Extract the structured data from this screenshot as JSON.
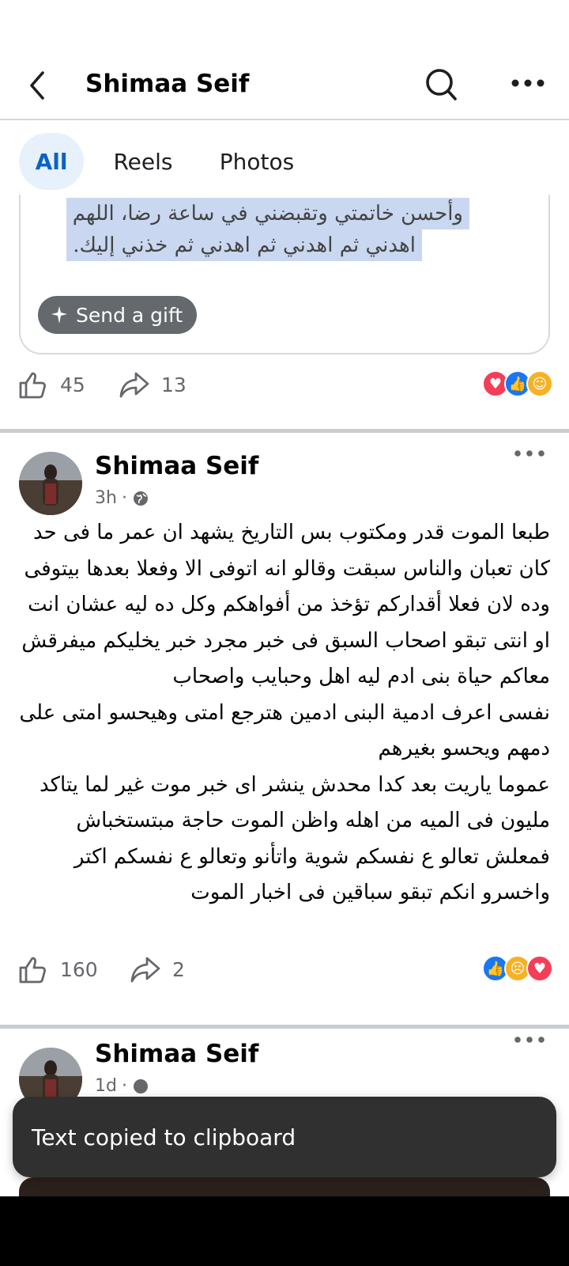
{
  "header": {
    "title": "Shimaa Seif"
  },
  "filters": [
    {
      "label": "All",
      "active": true
    },
    {
      "label": "Reels",
      "active": false
    },
    {
      "label": "Photos",
      "active": false
    }
  ],
  "post_prev": {
    "quote_lines": [
      "وأحسن خاتمتي وتقبضني في ساعة رضا، اللهم",
      "اهدني ثم اهدني ثم اهدني ثم خذني إليك."
    ],
    "gift_label": "Send a gift",
    "likes": "45",
    "shares": "13",
    "reactions": [
      "love",
      "like",
      "care"
    ]
  },
  "post_main": {
    "author": "Shimaa Seif",
    "time": "3h",
    "dot": "·",
    "text": "طبعا الموت قدر ومكتوب بس التاريخ يشهد ان عمر ما فى حد كان تعبان والناس سبقت وقالو انه اتوفى الا وفعلا بعدها بيتوفى وده لان فعلا أقداركم تؤخذ من أفواهكم وكل ده ليه عشان انت او انتى تبقو اصحاب السبق فى خبر مجرد خبر يخليكم ميفرقش معاكم حياة بنى ادم ليه اهل وحبايب واصحاب\nنفسى اعرف ادمية البنى ادمين هترجع امتى وهيحسو امتى على دمهم ويحسو بغيرهم\nعموما ياريت بعد كدا محدش ينشر اى خبر موت غير لما يتاكد مليون فى الميه من اهله واظن الموت حاجة مبتستخباش فمعلش تعالو ع نفسكم شوية واتأنو وتعالو ع نفسكم اكتر واخسرو انكم تبقو سباقين فى اخبار الموت",
    "likes": "160",
    "shares": "2",
    "reactions": [
      "like",
      "sad",
      "love"
    ]
  },
  "post_next": {
    "author": "Shimaa Seif",
    "time": "1d",
    "dot": "·"
  },
  "toast": {
    "message": "Text copied to clipboard"
  },
  "colors": {
    "accent": "#0b63c4",
    "chip_bg": "#e7f1fc",
    "toast_bg": "#303030",
    "love": "#f33e58",
    "like": "#1877f2",
    "care": "#f7b125"
  }
}
